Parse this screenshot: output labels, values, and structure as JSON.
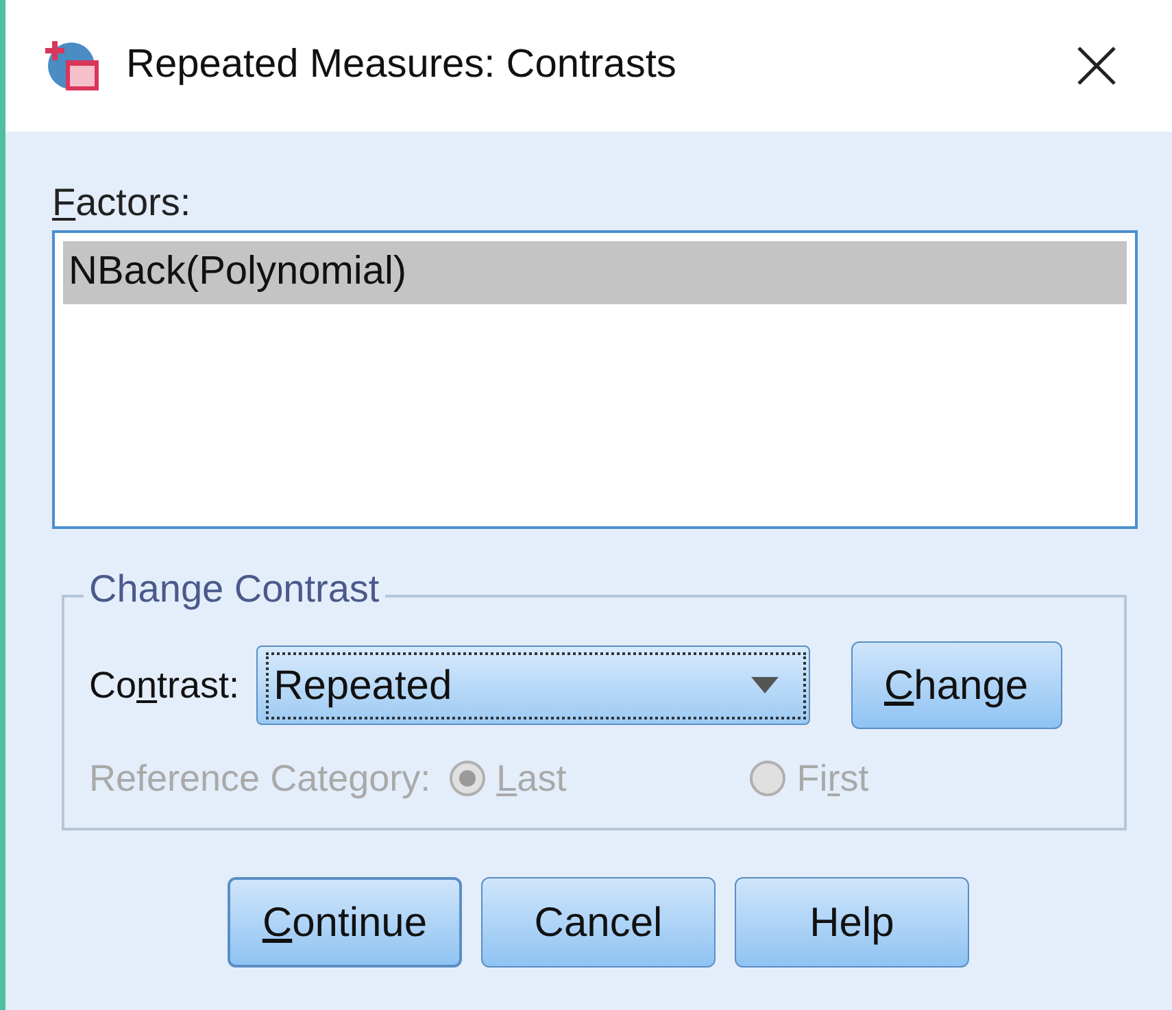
{
  "window": {
    "title": "Repeated Measures: Contrasts"
  },
  "factors": {
    "label": {
      "key": "F",
      "post": "actors:"
    },
    "items": [
      {
        "text": "NBack(Polynomial)",
        "selected": true
      }
    ]
  },
  "change_contrast": {
    "title": "Change Contrast",
    "contrast_label": {
      "pre": "Co",
      "key": "n",
      "post": "trast:"
    },
    "contrast_value": "Repeated",
    "change_button": {
      "key": "C",
      "post": "hange"
    },
    "reference_label": "Reference Category:",
    "disabled": true,
    "options": [
      {
        "label": {
          "key": "L",
          "post": "ast"
        },
        "selected": true
      },
      {
        "label": {
          "pre": "Fi",
          "key": "r",
          "post": "st"
        },
        "selected": false
      }
    ]
  },
  "buttons": [
    {
      "label": {
        "key": "C",
        "post": "ontinue"
      },
      "default": true
    },
    {
      "label": {
        "pre": "Cancel"
      },
      "default": false
    },
    {
      "label": {
        "pre": "Help"
      },
      "default": false
    }
  ]
}
